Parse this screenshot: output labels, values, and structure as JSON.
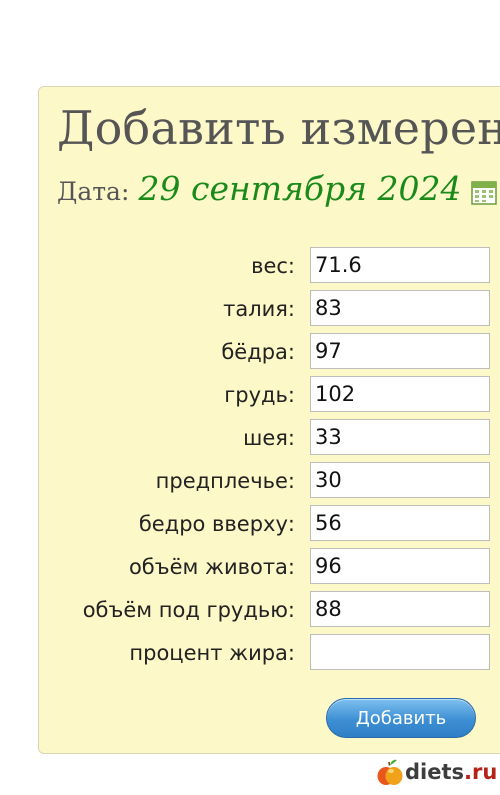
{
  "page": {
    "title": "Добавить измерения",
    "date_label": "Дата:",
    "date_value": "29 сентября 2024"
  },
  "icons": {
    "calendar": "calendar-icon",
    "brand_logo": "apple-logo"
  },
  "fields": [
    {
      "label": "вес:",
      "value": "71.6"
    },
    {
      "label": "талия:",
      "value": "83"
    },
    {
      "label": "бёдра:",
      "value": "97"
    },
    {
      "label": "грудь:",
      "value": "102"
    },
    {
      "label": "шея:",
      "value": "33"
    },
    {
      "label": "предплечье:",
      "value": "30"
    },
    {
      "label": "бедро вверху:",
      "value": "56"
    },
    {
      "label": "объём живота:",
      "value": "96"
    },
    {
      "label": "объём под грудью:",
      "value": "88"
    },
    {
      "label": "процент жира:",
      "value": ""
    }
  ],
  "buttons": {
    "add": "Добавить"
  },
  "brand": {
    "name": "diets",
    "tld": ".ru"
  },
  "colors": {
    "panel_bg": "#fdf8c8",
    "date_green": "#1a8a1a",
    "button_blue": "#3d8fd4"
  }
}
